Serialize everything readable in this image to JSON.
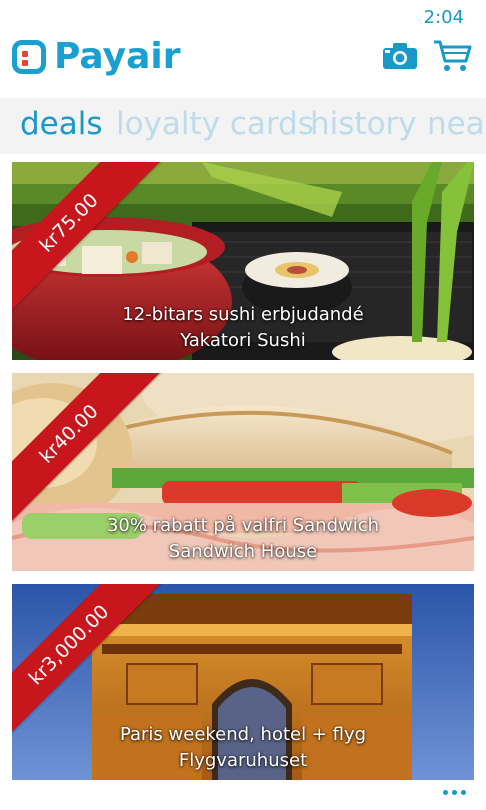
{
  "status": {
    "time": "2:04"
  },
  "header": {
    "app_name": "Payair",
    "camera_icon": "camera-icon",
    "cart_icon": "shopping-cart-icon"
  },
  "tabs": [
    {
      "label": "deals",
      "active": true
    },
    {
      "label": "loyalty cards",
      "active": false
    },
    {
      "label": "history",
      "active": false
    },
    {
      "label": "near",
      "active": false
    }
  ],
  "deals": [
    {
      "price": "kr75.00",
      "title": "12-bitars sushi erbjudandé",
      "merchant": "Yakatori Sushi"
    },
    {
      "price": "kr40.00",
      "title": "30% rabatt på valfri Sandwich",
      "merchant": "Sandwich House"
    },
    {
      "price": "kr3,000.00",
      "title": "Paris weekend, hotel + flyg",
      "merchant": "Flygvaruhuset"
    }
  ],
  "app_bar": {
    "more_icon": "more-dots-icon"
  },
  "colors": {
    "accent": "#1a98c8",
    "ribbon": "#c8161d",
    "inactive_tab": "#bcdcea",
    "logo_dot": "#e8452c"
  }
}
